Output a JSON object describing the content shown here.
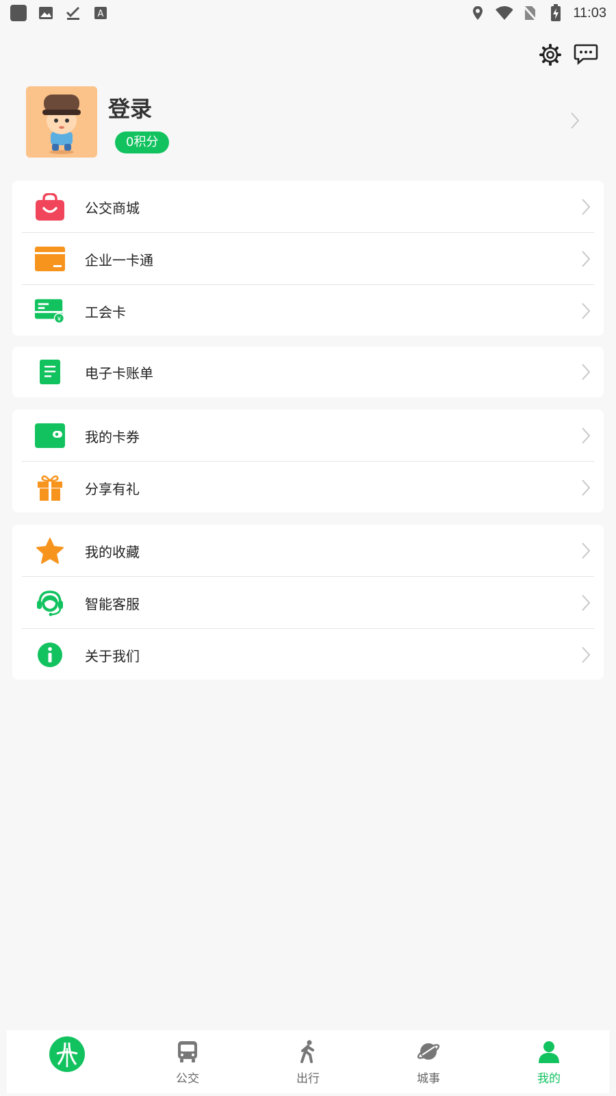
{
  "status_bar": {
    "time": "11:03",
    "left_icons": [
      "app-square-icon",
      "image-icon",
      "download-done-icon",
      "text-a-icon"
    ],
    "right_icons": [
      "location-icon",
      "wifi-icon",
      "no-sim-icon",
      "battery-charging-icon"
    ]
  },
  "top_actions": {
    "settings_icon": "gear-icon",
    "message_icon": "chat-bubble-icon"
  },
  "profile": {
    "title": "登录",
    "points": "0积分",
    "avatar_icon": "mascot-avatar"
  },
  "menu_groups": [
    [
      {
        "label": "公交商城",
        "icon": "shopping-bag-icon"
      },
      {
        "label": "企业一卡通",
        "icon": "card-icon"
      },
      {
        "label": "工会卡",
        "icon": "union-card-icon"
      }
    ],
    [
      {
        "label": "电子卡账单",
        "icon": "bill-icon"
      }
    ],
    [
      {
        "label": "我的卡券",
        "icon": "wallet-icon"
      },
      {
        "label": "分享有礼",
        "icon": "gift-icon"
      }
    ],
    [
      {
        "label": "我的收藏",
        "icon": "star-icon"
      },
      {
        "label": "智能客服",
        "icon": "headset-icon"
      },
      {
        "label": "关于我们",
        "icon": "info-icon"
      }
    ]
  ],
  "bottom_nav": [
    {
      "label": "",
      "icon": "logo-icon"
    },
    {
      "label": "公交",
      "icon": "bus-icon"
    },
    {
      "label": "出行",
      "icon": "walking-icon"
    },
    {
      "label": "城事",
      "icon": "planet-icon"
    },
    {
      "label": "我的",
      "icon": "person-icon"
    }
  ],
  "colors": {
    "accent": "#12c25f",
    "shop": "#f0455a",
    "card": "#f7941d",
    "gift": "#f7941d",
    "star": "#f7941d"
  }
}
